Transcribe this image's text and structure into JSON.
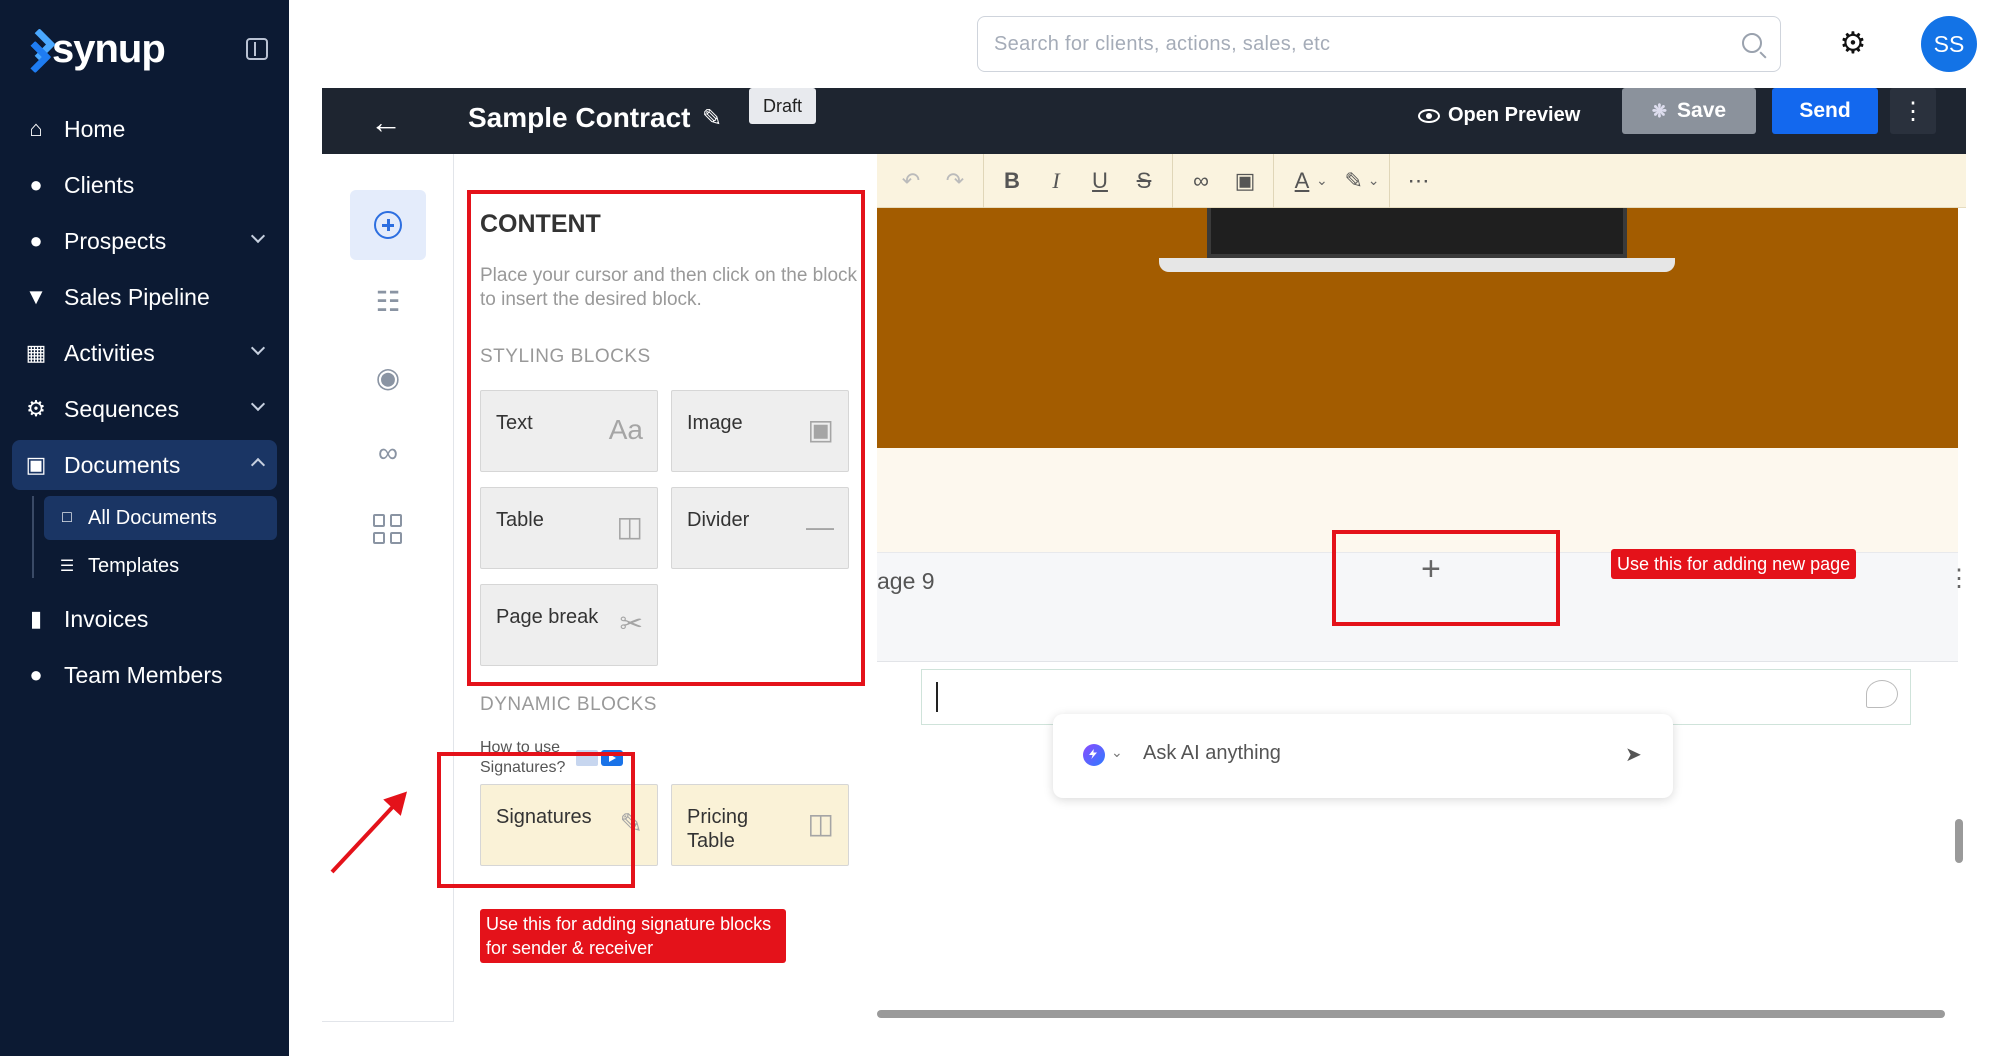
{
  "brand": {
    "name": "synup",
    "accent": "#1373e6",
    "sidebar_bg": "#0c1a33"
  },
  "sidebar": {
    "items": [
      {
        "label": "Home",
        "icon": "home-icon"
      },
      {
        "label": "Clients",
        "icon": "user-icon"
      },
      {
        "label": "Prospects",
        "icon": "users-icon"
      },
      {
        "label": "Sales Pipeline",
        "icon": "funnel-icon"
      },
      {
        "label": "Activities",
        "icon": "calendar-icon"
      },
      {
        "label": "Sequences",
        "icon": "gear-icon"
      },
      {
        "label": "Documents",
        "icon": "document-icon"
      },
      {
        "label": "Invoices",
        "icon": "invoice-icon"
      },
      {
        "label": "Team Members",
        "icon": "team-icon"
      }
    ],
    "documents_sub": [
      {
        "label": "All Documents",
        "icon": "file-icon"
      },
      {
        "label": "Templates",
        "icon": "template-icon"
      }
    ]
  },
  "topbar": {
    "search_placeholder": "Search for clients, actions, sales, etc",
    "avatar_initials": "SS"
  },
  "editor": {
    "title": "Sample Contract",
    "status": "Draft",
    "open_preview": "Open Preview",
    "save": "Save",
    "send": "Send"
  },
  "content_panel": {
    "title": "CONTENT",
    "help": "Place your cursor and then click on the block to insert the desired block.",
    "styling_label": "STYLING BLOCKS",
    "styling_blocks": [
      {
        "label": "Text",
        "icon": "text-icon"
      },
      {
        "label": "Image",
        "icon": "image-icon"
      },
      {
        "label": "Table",
        "icon": "table-icon"
      },
      {
        "label": "Divider",
        "icon": "divider-icon"
      },
      {
        "label": "Page break",
        "icon": "scissors-icon"
      }
    ],
    "dynamic_label": "DYNAMIC BLOCKS",
    "how_to": "How to use Signatures?",
    "dynamic_blocks": [
      {
        "label": "Signatures",
        "icon": "pen-icon"
      },
      {
        "label": "Pricing Table",
        "icon": "pricing-table-icon"
      }
    ]
  },
  "annotations": {
    "new_page": "Use this for adding new page",
    "signature": "Use this for adding signature blocks for sender & receiver",
    "color": "#e4121a"
  },
  "canvas": {
    "page_label": "age 9",
    "ai_placeholder": "Ask AI anything"
  }
}
